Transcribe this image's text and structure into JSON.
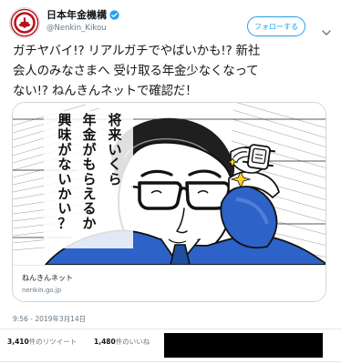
{
  "header": {
    "display_name": "日本年金機構",
    "handle": "@Nenkin_Kikou",
    "follow_label": "フォローする",
    "avatar_logo_name": "nenkin-seal-logo"
  },
  "tweet": {
    "text": "ガチヤバイ!? リアルガチでやばいかも!? 新社\n会人のみなさまへ 受け取る年金少なくなって\nない!?  ねんきんネットで確認だ！"
  },
  "card": {
    "image_caption_lines": [
      "将来いくら",
      "年金がもらえるか",
      "興味がないかい？"
    ],
    "title": "ねんきんネット",
    "domain": "nenkin.go.jp"
  },
  "meta": {
    "timestamp": "9:56 - 2019年3月14日"
  },
  "stats": {
    "retweets": {
      "value": "3,410",
      "label": "件のリツイート"
    },
    "likes": {
      "value": "1,480",
      "label": "件のいいね"
    }
  },
  "colors": {
    "accent": "#1da1f2",
    "text": "#14171a",
    "muted": "#657786",
    "border": "#ccd6dd",
    "suit_blue": "#2d63c8",
    "seal_red": "#b5121b"
  },
  "icons": {
    "verified": "verified-badge-icon",
    "menu": "chevron-down-icon"
  }
}
